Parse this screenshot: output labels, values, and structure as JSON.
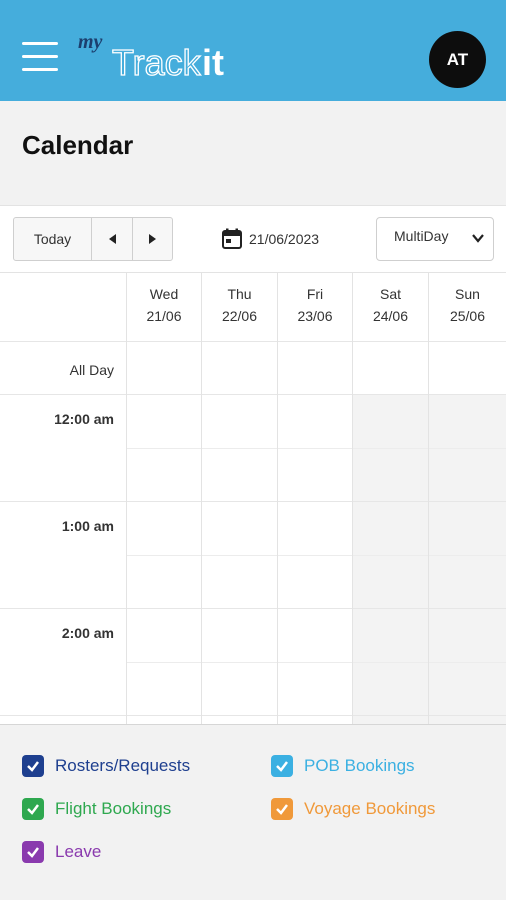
{
  "header": {
    "logo_prefix": "my",
    "logo_main": "Track",
    "logo_suffix": "it",
    "avatar_initials": "AT",
    "bg_color": "#45addc"
  },
  "page": {
    "title": "Calendar"
  },
  "toolbar": {
    "today_label": "Today",
    "date_value": "21/06/2023",
    "view_value": "MultiDay"
  },
  "calendar": {
    "days": [
      {
        "weekday": "Wed",
        "date": "21/06",
        "weekend": false
      },
      {
        "weekday": "Thu",
        "date": "22/06",
        "weekend": false
      },
      {
        "weekday": "Fri",
        "date": "23/06",
        "weekend": false
      },
      {
        "weekday": "Sat",
        "date": "24/06",
        "weekend": true
      },
      {
        "weekday": "Sun",
        "date": "25/06",
        "weekend": true
      }
    ],
    "all_day_label": "All Day",
    "time_slots": [
      "12:00 am",
      "1:00 am",
      "2:00 am"
    ]
  },
  "filters": [
    {
      "label": "Rosters/Requests",
      "color": "#1e3f8f",
      "checked": true
    },
    {
      "label": "POB Bookings",
      "color": "#3bb0e2",
      "checked": true
    },
    {
      "label": "Flight Bookings",
      "color": "#2ea84f",
      "checked": true
    },
    {
      "label": "Voyage Bookings",
      "color": "#f0993a",
      "checked": true
    },
    {
      "label": "Leave",
      "color": "#8a3aae",
      "checked": true
    }
  ]
}
